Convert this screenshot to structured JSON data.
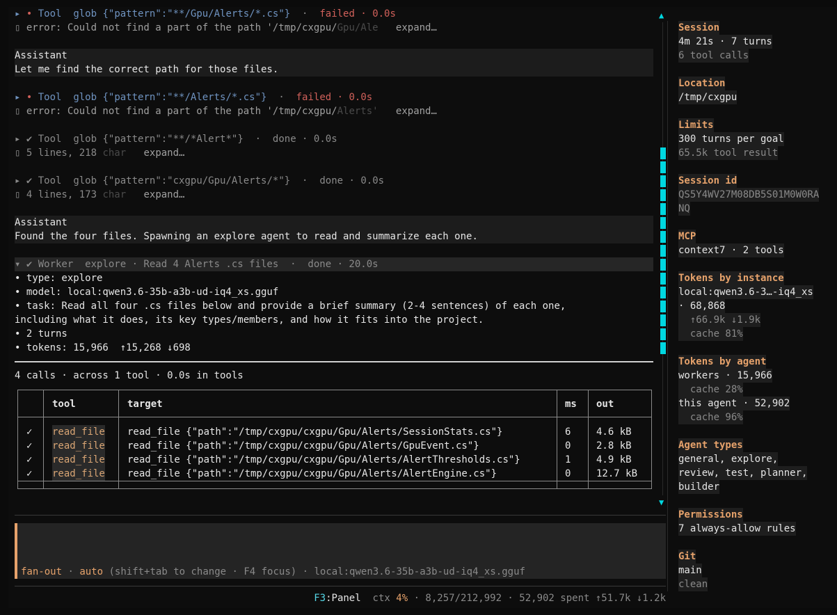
{
  "log": {
    "tool1": {
      "status_dot": "•",
      "label": "Tool",
      "cmd": "glob {\"pattern\":\"**/Gpu/Alerts/*.cs\"}",
      "sep": "·",
      "status": "failed · 0.0s",
      "err": "error: Could not find a part of the path '/tmp/cxgpu/",
      "err_fade": "Gpu/Ale",
      "expand": "expand…"
    },
    "assistant1": {
      "label": "Assistant",
      "text": "Let me find the correct path for those files."
    },
    "tool2": {
      "status_dot": "•",
      "label": "Tool",
      "cmd": "glob {\"pattern\":\"**/Alerts/*.cs\"}",
      "sep": "·",
      "status": "failed · 0.0s",
      "err": "error: Could not find a part of the path '/tmp/cxgpu/",
      "err_fade": "Alerts'",
      "expand": "expand…"
    },
    "tool3": {
      "status_dot": "✔",
      "label": "Tool",
      "cmd": "glob {\"pattern\":\"**/*Alert*\"}",
      "sep": "·",
      "status": "done · 0.0s",
      "summary": "5 lines, 218",
      "summary_fade": "char",
      "expand": "expand…"
    },
    "tool4": {
      "status_dot": "✔",
      "label": "Tool",
      "cmd": "glob {\"pattern\":\"cxgpu/Gpu/Alerts/*\"}",
      "sep": "·",
      "status": "done · 0.0s",
      "summary": "4 lines, 173",
      "summary_fade": "char",
      "expand": "expand…"
    },
    "assistant2": {
      "label": "Assistant",
      "text": "Found the four files. Spawning an explore agent to read and summarize each one."
    },
    "worker": {
      "header": "▾ ✔ Worker  explore · Read 4 Alerts .cs files  ·  done · 20.0s",
      "lines": [
        "• type: explore",
        "• model: local:qwen3.6-35b-a3b-ud-iq4_xs.gguf",
        "• task: Read all four .cs files below and provide a brief summary (2-4 sentences) of each one,",
        "including what it does, its key types/members, and how it fits into the project.",
        "• 2 turns",
        "• tokens: 15,966  ↑15,268 ↓698"
      ]
    },
    "calls_summary": "4 calls · across 1 tool · 0.0s in tools",
    "table": {
      "headers": {
        "tool": "tool",
        "target": "target",
        "ms": "ms",
        "out": "out"
      },
      "rows": [
        {
          "check": "✓",
          "tool": "read_file",
          "target": "read_file {\"path\":\"/tmp/cxgpu/cxgpu/Gpu/Alerts/SessionStats.cs\"}",
          "ms": "6",
          "out": "4.6 kB"
        },
        {
          "check": "✓",
          "tool": "read_file",
          "target": "read_file {\"path\":\"/tmp/cxgpu/cxgpu/Gpu/Alerts/GpuEvent.cs\"}",
          "ms": "0",
          "out": "2.8 kB"
        },
        {
          "check": "✓",
          "tool": "read_file",
          "target": "read_file {\"path\":\"/tmp/cxgpu/cxgpu/Gpu/Alerts/AlertThresholds.cs\"}",
          "ms": "1",
          "out": "4.9 kB"
        },
        {
          "check": "✓",
          "tool": "read_file",
          "target": "read_file {\"path\":\"/tmp/cxgpu/cxgpu/Gpu/Alerts/AlertEngine.cs\"}",
          "ms": "0",
          "out": "12.7 kB"
        }
      ]
    }
  },
  "input": {
    "mode": "fan-out",
    "sep1": "·",
    "auto": "auto",
    "hint": "(shift+tab to change · F4 focus) · local:qwen3.6-35b-a3b-ud-iq4_xs.gguf"
  },
  "statusbar": {
    "f3": "F3",
    "panel": ":Panel",
    "ctx_label": "ctx",
    "ctx_pct": "4%",
    "rest": "· 8,257/212,992 · 52,902 spent ↑51.7k ↓1.2k"
  },
  "sidebar": {
    "session": {
      "title": "Session",
      "line1": "4m 21s · 7 turns",
      "line2": "6 tool calls"
    },
    "location": {
      "title": "Location",
      "line1": "/tmp/cxgpu"
    },
    "limits": {
      "title": "Limits",
      "line1": "300 turns per goal",
      "line2": "65.5k tool result"
    },
    "session_id": {
      "title": "Session id",
      "line1": "QS5Y4WV27M08DB5S01M0W0RA",
      "line2": "NQ"
    },
    "mcp": {
      "title": "MCP",
      "line1": "context7 · 2 tools"
    },
    "tokens_instance": {
      "title": "Tokens by instance",
      "line1": "local:qwen3.6-3…-iq4_xs",
      "line2": "· 68,868",
      "line3": "  ↑66.9k ↓1.9k",
      "line4": "  cache 81%"
    },
    "tokens_agent": {
      "title": "Tokens by agent",
      "line1": "workers · 15,966",
      "line2": "  cache 28%",
      "line3": "this agent · 52,902",
      "line4": "  cache 96%"
    },
    "agent_types": {
      "title": "Agent types",
      "line1": "general, explore,",
      "line2": "review, test, planner,",
      "line3": "builder"
    },
    "permissions": {
      "title": "Permissions",
      "line1": "7 always-allow rules"
    },
    "git": {
      "title": "Git",
      "line1": "main",
      "line2": "clean"
    }
  }
}
